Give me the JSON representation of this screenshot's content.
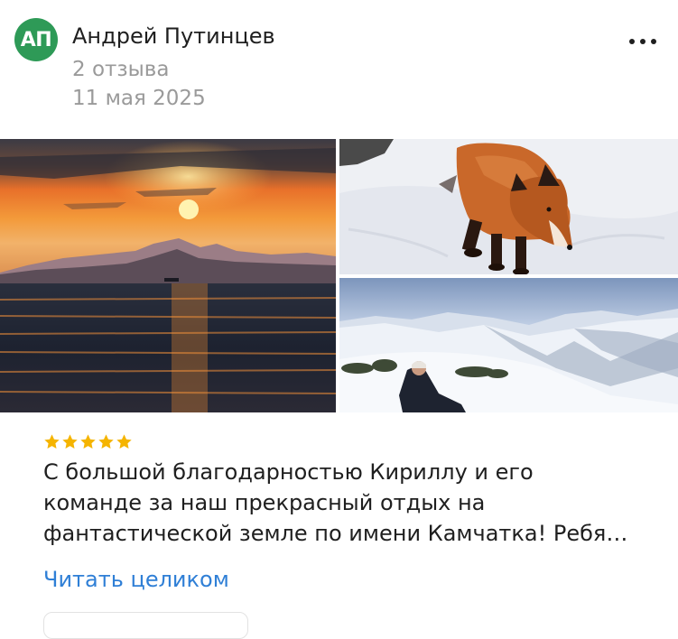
{
  "review": {
    "author": {
      "initials": "АП",
      "name": "Андрей Путинцев",
      "reviews_count": "2 отзыва",
      "avatar_color": "#2e9a57"
    },
    "date": "11 мая 2025",
    "menu_icon": "more-dots-icon",
    "rating": {
      "stars": 5,
      "max": 5,
      "color": "#f5b400"
    },
    "text_lines": [
      "С большой благодарностью Кириллу и его",
      "команде за наш прекрасный отдых на",
      "фантастической земле по имени Камчатка! Ребя…"
    ],
    "read_more": "Читать целиком",
    "link_color": "#2f7fd6"
  }
}
